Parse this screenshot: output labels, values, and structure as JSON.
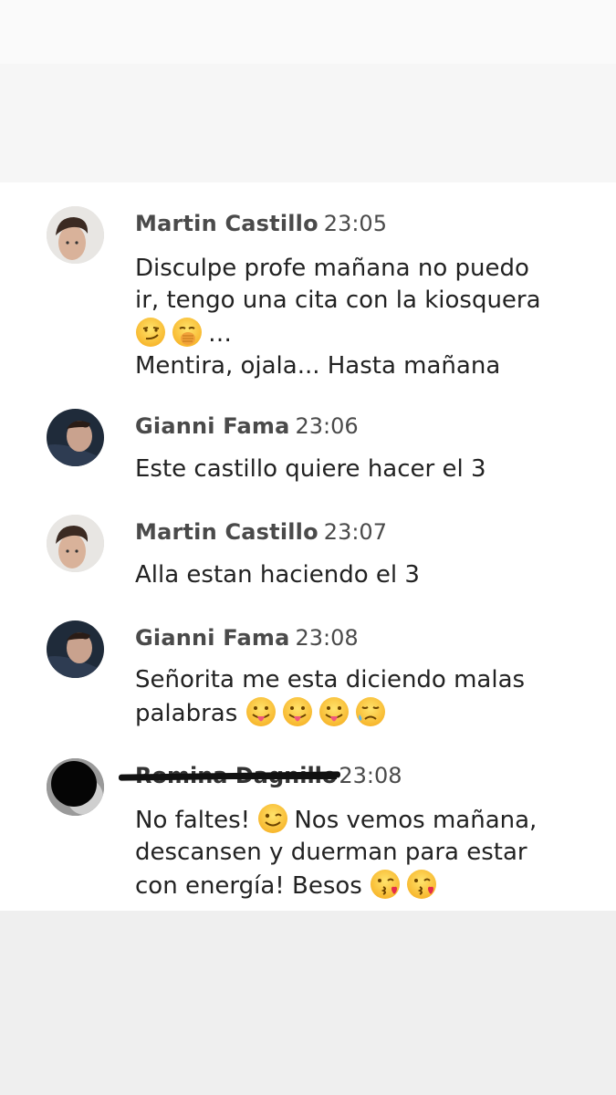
{
  "messages": [
    {
      "author": "Martin Castillo",
      "time": "23:05",
      "avatar": "boy-avatar",
      "lines": [
        "Disculpe profe mañana no puedo",
        "ir, tengo una cita con la kiosquera",
        "…",
        "Mentira, ojala... Hasta mañana"
      ],
      "emojis": [
        "smirk-emoji",
        "hand-over-mouth-emoji"
      ]
    },
    {
      "author": "Gianni Fama",
      "time": "23:06",
      "avatar": "boy-dark-avatar",
      "lines": [
        "Este castillo quiere hacer el 3"
      ]
    },
    {
      "author": "Martin Castillo",
      "time": "23:07",
      "avatar": "boy-avatar",
      "lines": [
        "Alla estan haciendo el 3"
      ]
    },
    {
      "author": "Gianni Fama",
      "time": "23:08",
      "avatar": "boy-dark-avatar",
      "lines": [
        "Señorita me esta diciendo malas",
        "palabras"
      ],
      "emojis": [
        "tongue-out-emoji",
        "tongue-out-emoji",
        "tongue-out-emoji",
        "sad-sweat-emoji"
      ]
    },
    {
      "author": "Romina Dagnillo",
      "author_redacted": true,
      "time": "23:08",
      "avatar": "redacted-avatar",
      "lines": [
        "No faltes!",
        "Nos vemos mañana,",
        "descansen y duerman para estar",
        "con energía! Besos"
      ],
      "emojis": [
        "wink-emoji",
        "kiss-emoji",
        "kiss-emoji"
      ]
    }
  ]
}
